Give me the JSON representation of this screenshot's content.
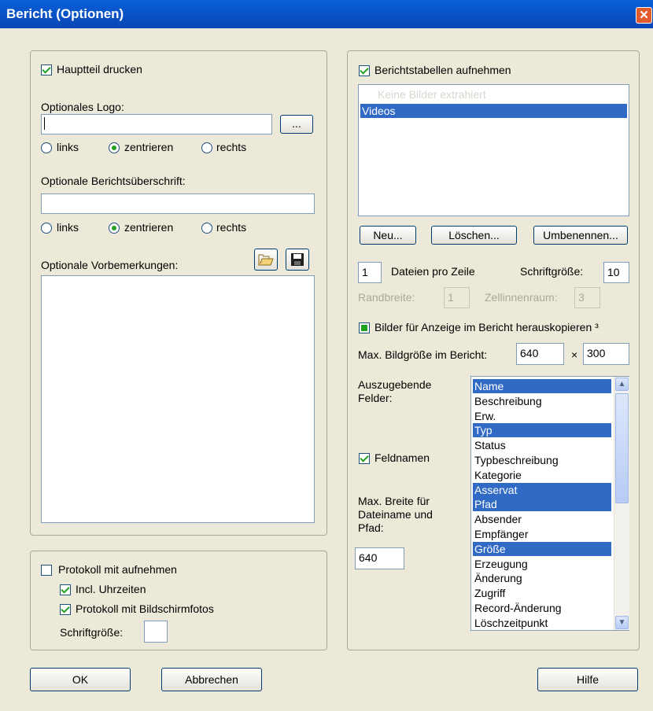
{
  "window": {
    "title": "Bericht (Optionen)",
    "close_glyph": "✕"
  },
  "left": {
    "print_main": {
      "label": "Hauptteil drucken",
      "checked": true
    },
    "logo": {
      "label": "Optionales Logo:",
      "value": "",
      "browse_label": "...",
      "align": {
        "left": "links",
        "center": "zentrieren",
        "right": "rechts",
        "selected": "zentrieren"
      }
    },
    "heading": {
      "label": "Optionale Berichtsüberschrift:",
      "value": "",
      "align": {
        "left": "links",
        "center": "zentrieren",
        "right": "rechts",
        "selected": "zentrieren"
      }
    },
    "remarks": {
      "label": "Optionale Vorbemerkungen:",
      "value": ""
    }
  },
  "protocol": {
    "include": {
      "label": "Protokoll mit aufnehmen",
      "checked": false
    },
    "times": {
      "label": "Incl. Uhrzeiten",
      "checked": true
    },
    "screenshots": {
      "label": "Protokoll mit Bildschirmfotos",
      "checked": true
    },
    "font_size": {
      "label": "Schriftgröße:",
      "value": ""
    }
  },
  "right": {
    "tables": {
      "label": "Berichtstabellen aufnehmen",
      "checked": true,
      "items": [
        {
          "text": "Keine Bilder extrahiert",
          "state": "disabled"
        },
        {
          "text": "Videos",
          "state": "selected"
        }
      ],
      "new_label": "Neu...",
      "delete_label": "Löschen...",
      "rename_label": "Umbenennen..."
    },
    "files_per_row": {
      "value": "1",
      "label": "Dateien pro Zeile"
    },
    "font_size": {
      "label": "Schriftgröße:",
      "value": "10"
    },
    "border_width": {
      "label": "Randbreite:",
      "value": "1"
    },
    "cell_spacing": {
      "label": "Zellinnenraum:",
      "value": "3"
    },
    "copy_images": {
      "label": "Bilder für Anzeige im Bericht herauskopieren ³",
      "state": "indeterminate"
    },
    "max_image": {
      "label": "Max. Bildgröße im Bericht:",
      "width": "640",
      "times": "×",
      "height": "300"
    },
    "fields": {
      "label": "Auszugebende Felder:",
      "items": [
        {
          "text": "Name",
          "selected": true
        },
        {
          "text": "Beschreibung",
          "selected": false
        },
        {
          "text": "Erw.",
          "selected": false
        },
        {
          "text": "Typ",
          "selected": true
        },
        {
          "text": "Status",
          "selected": false
        },
        {
          "text": "Typbeschreibung",
          "selected": false
        },
        {
          "text": "Kategorie",
          "selected": false
        },
        {
          "text": "Asservat",
          "selected": true
        },
        {
          "text": "Pfad",
          "selected": true
        },
        {
          "text": "Absender",
          "selected": false
        },
        {
          "text": "Empfänger",
          "selected": false
        },
        {
          "text": "Größe",
          "selected": true
        },
        {
          "text": "Erzeugung",
          "selected": false
        },
        {
          "text": "Änderung",
          "selected": false
        },
        {
          "text": "Zugriff",
          "selected": false
        },
        {
          "text": "Record-Änderung",
          "selected": false
        },
        {
          "text": "Löschzeitpunkt",
          "selected": false
        }
      ]
    },
    "field_names": {
      "label": "Feldnamen",
      "checked": true
    },
    "max_width": {
      "label": "Max. Breite für Dateiname und Pfad:",
      "value": "640"
    }
  },
  "footer": {
    "ok_label": "OK",
    "cancel_label": "Abbrechen",
    "help_label": "Hilfe"
  }
}
